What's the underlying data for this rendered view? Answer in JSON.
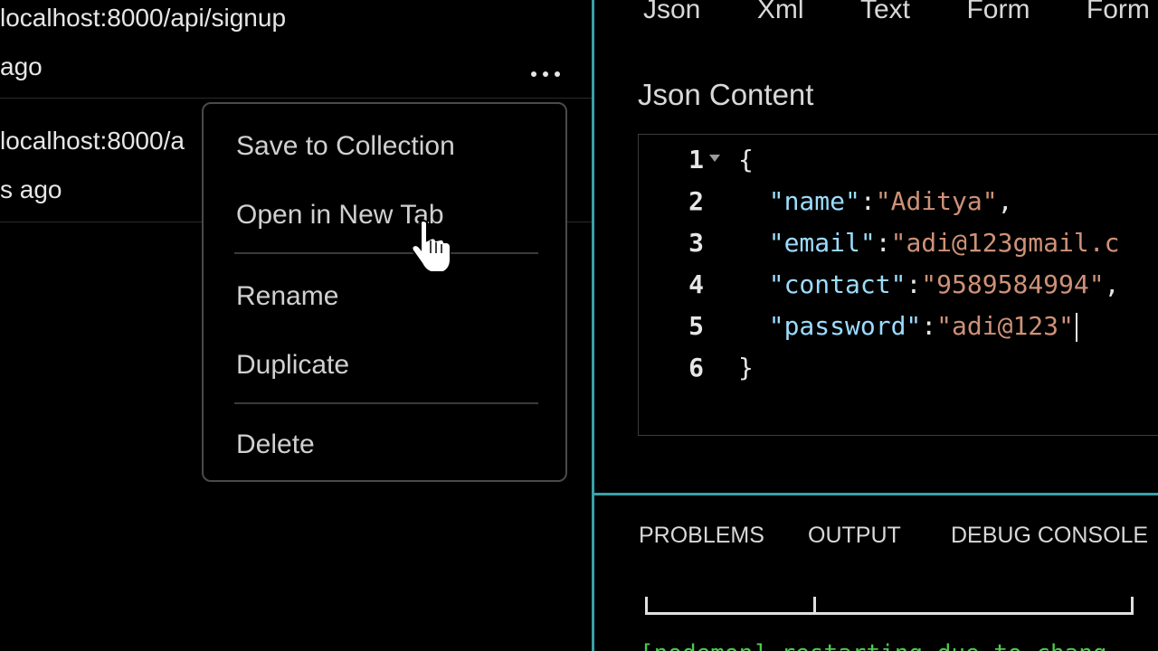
{
  "history": {
    "items": [
      {
        "url": "localhost:8000/api/signup",
        "time": "ago",
        "more_icon": "ellipsis-icon"
      },
      {
        "url": "localhost:8000/a",
        "time": "s ago"
      }
    ]
  },
  "context_menu": {
    "items": [
      "Save to Collection",
      "Open in New Tab",
      "Rename",
      "Duplicate",
      "Delete"
    ]
  },
  "body_tabs": [
    "Json",
    "Xml",
    "Text",
    "Form",
    "Form"
  ],
  "section_title": "Json Content",
  "editor": {
    "lines": [
      {
        "num": "1",
        "parts": [
          {
            "t": "{",
            "c": "p"
          }
        ]
      },
      {
        "num": "2",
        "parts": [
          {
            "t": "  ",
            "c": "p"
          },
          {
            "t": "\"name\"",
            "c": "k"
          },
          {
            "t": ":",
            "c": "p"
          },
          {
            "t": "\"Aditya\"",
            "c": "s"
          },
          {
            "t": ",",
            "c": "p"
          }
        ]
      },
      {
        "num": "3",
        "parts": [
          {
            "t": "  ",
            "c": "p"
          },
          {
            "t": "\"email\"",
            "c": "k"
          },
          {
            "t": ":",
            "c": "p"
          },
          {
            "t": "\"adi@123gmail.c",
            "c": "s"
          }
        ]
      },
      {
        "num": "4",
        "parts": [
          {
            "t": "  ",
            "c": "p"
          },
          {
            "t": "\"contact\"",
            "c": "k"
          },
          {
            "t": ":",
            "c": "p"
          },
          {
            "t": "\"9589584994\"",
            "c": "s"
          },
          {
            "t": ",",
            "c": "p"
          }
        ]
      },
      {
        "num": "5",
        "parts": [
          {
            "t": "  ",
            "c": "p"
          },
          {
            "t": "\"password\"",
            "c": "k"
          },
          {
            "t": ":",
            "c": "p"
          },
          {
            "t": "\"adi@123\"",
            "c": "s"
          }
        ]
      },
      {
        "num": "6",
        "parts": [
          {
            "t": "}",
            "c": "p"
          }
        ]
      }
    ]
  },
  "bottom_panel": {
    "tabs": [
      "PROBLEMS",
      "OUTPUT",
      "DEBUG CONSOLE"
    ],
    "terminal_line": "[nodemon] restarting due to chang"
  },
  "colors": {
    "accent_divider": "#3aa0a8",
    "json_key": "#9cdcfe",
    "json_string": "#ce9178",
    "terminal_text": "#4ec94e"
  }
}
